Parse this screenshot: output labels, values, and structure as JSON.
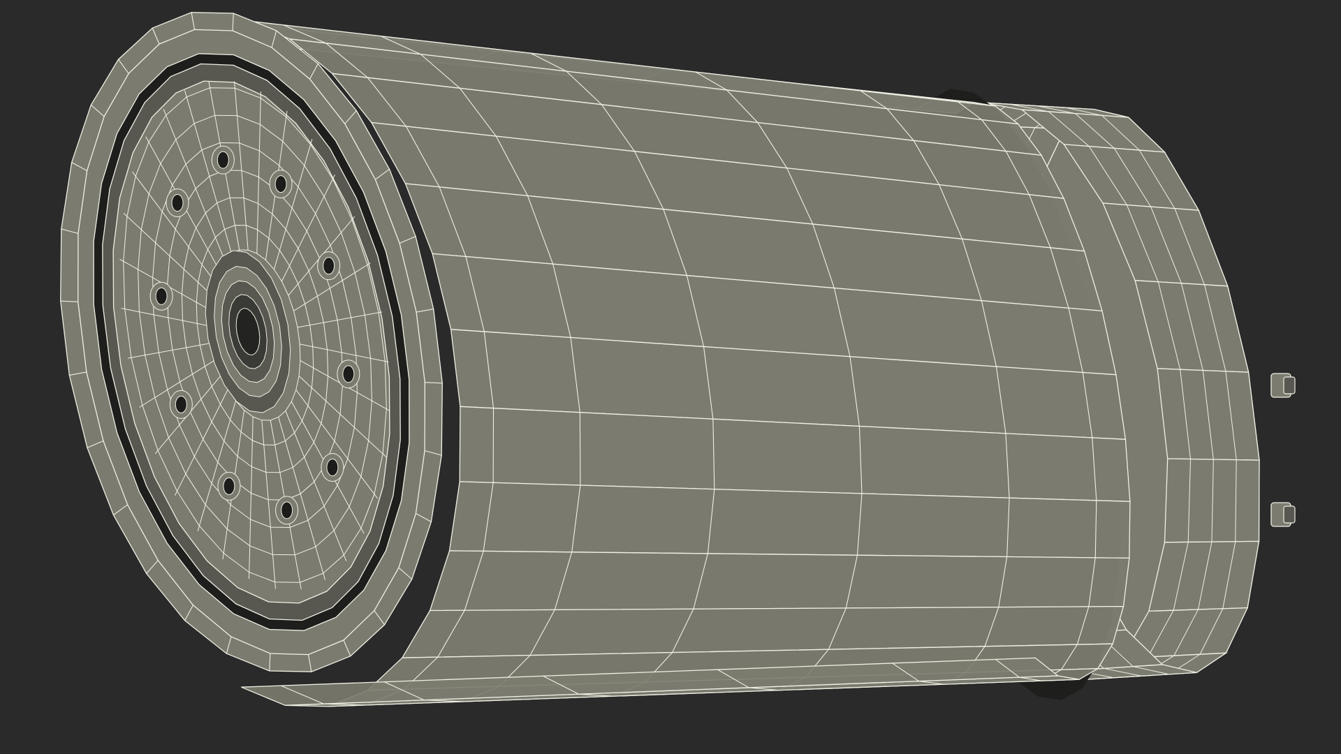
{
  "scene": {
    "subject": "wireframe-render-of-cylindrical-filter",
    "background_color": "#2a2a2a",
    "surface_color": "#7b7b6f",
    "surface_dark_color": "#585850",
    "groove_color": "#1e1e1c",
    "wire_color": "#f0f0e6",
    "face_holes": 10,
    "rear_pegs": 2
  }
}
